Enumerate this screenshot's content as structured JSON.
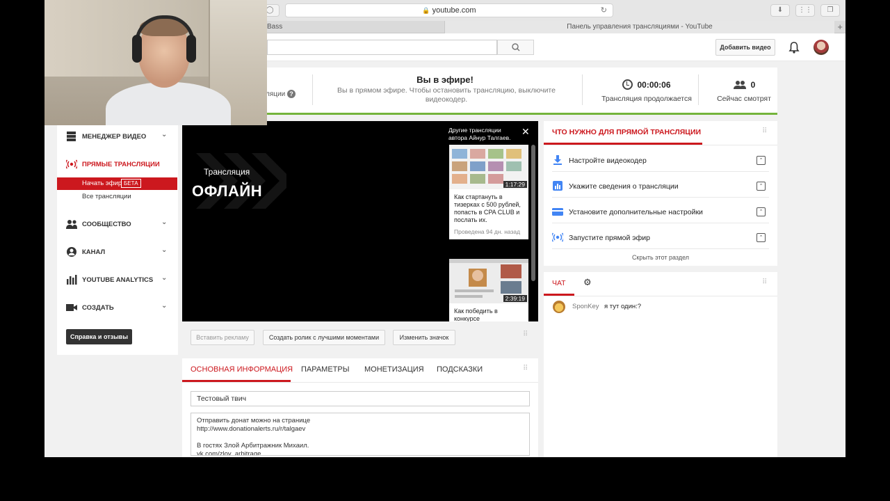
{
  "browser": {
    "address": "youtube.com",
    "tabs": [
      {
        "label": "Bass"
      },
      {
        "label": "Панель управления трансляциями - YouTube"
      }
    ]
  },
  "header": {
    "add_video_label": "Добавить видео"
  },
  "status": {
    "help_label": "ляции",
    "onair_title": "Вы в эфире!",
    "onair_text": "Вы в прямом эфире. Чтобы остановить трансляцию, выключите видеокодер.",
    "timer_value": "00:00:06",
    "timer_label": "Трансляция продолжается",
    "viewers_value": "0",
    "viewers_label": "Сейчас смотрят"
  },
  "sidebar": {
    "items": [
      {
        "label": "Менеджер видео"
      },
      {
        "label": "Прямые трансляции"
      },
      {
        "label": "Сообщество"
      },
      {
        "label": "Канал"
      },
      {
        "label": "YouTube Analytics"
      },
      {
        "label": "Создать"
      }
    ],
    "sub_start": "Начать эфир",
    "sub_beta": "БЕТА",
    "sub_all": "Все трансляции",
    "help_label": "Справка и отзывы"
  },
  "player": {
    "offline_small": "Трансляция",
    "offline_big": "ОФЛАЙН",
    "other_title": "Другие трансляции автора Айнур Талгаев.",
    "cards": [
      {
        "duration": "1:17:29",
        "title": "Как стартануть в тизерках с 500 рублей, попасть в CPA CLUB и послать их.",
        "meta": "Проведена 94 дн. назад"
      },
      {
        "duration": "2:39:19",
        "title": "Как победить в конкурсе",
        "meta": ""
      }
    ]
  },
  "player_actions": {
    "insert_ad": "Вставить рекламу",
    "highlights": "Создать ролик с лучшими моментами",
    "change_thumb": "Изменить значок"
  },
  "info": {
    "tabs": [
      {
        "label": "ОСНОВНАЯ ИНФОРМАЦИЯ"
      },
      {
        "label": "ПАРАМЕТРЫ"
      },
      {
        "label": "МОНЕТИЗАЦИЯ"
      },
      {
        "label": "ПОДСКАЗКИ"
      }
    ],
    "title_value": "Тестовый твич",
    "description_value": "Отправить донат можно на странице\nhttp://www.donationalerts.ru/r/talgaev\n\nВ гостях Злой Арбитражник Михаил.\nvk.com/zloy_arbitrage"
  },
  "requirements": {
    "title": "ЧТО НУЖНО ДЛЯ ПРЯМОЙ ТРАНСЛЯЦИИ",
    "rows": [
      {
        "label": "Настройте видеокодер"
      },
      {
        "label": "Укажите сведения о трансляции"
      },
      {
        "label": "Установите дополнительные настройки"
      },
      {
        "label": "Запустите прямой эфир"
      }
    ],
    "hide_label": "Скрыть этот раздел"
  },
  "chat": {
    "title": "ЧАТ",
    "messages": [
      {
        "user": "SponKey",
        "text": "я тут один:?"
      }
    ]
  },
  "colors": {
    "accent": "#cc181e",
    "live_bar": "#74b43b",
    "icon_blue": "#4285f4"
  }
}
